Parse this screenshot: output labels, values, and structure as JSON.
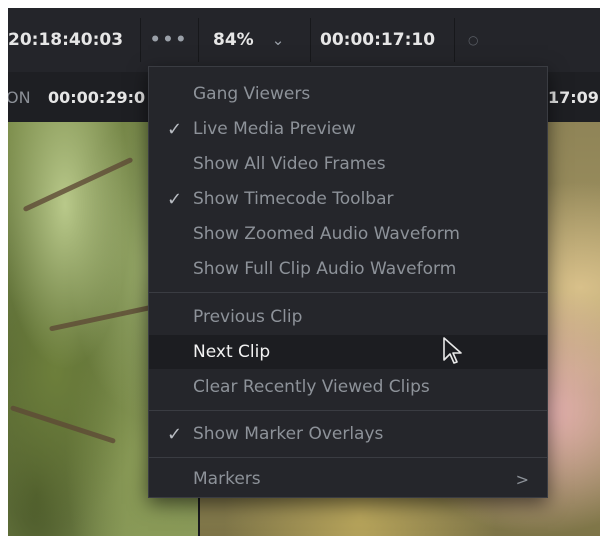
{
  "toolbar": {
    "timecode_left": "20:18:40:03",
    "options_label": "•••",
    "zoom_value": "84%",
    "zoom_chevron": "⌄",
    "timecode_right": "00:00:17:10",
    "status_dot": "○"
  },
  "row2": {
    "left_tag": "ON",
    "timecode_left": "00:00:29:0",
    "timecode_right": "17:09"
  },
  "menu": {
    "items": [
      {
        "label": "Gang Viewers",
        "checked": false,
        "check_glyph": ""
      },
      {
        "label": "Live Media Preview",
        "checked": true,
        "check_glyph": "✓"
      },
      {
        "label": "Show All Video Frames",
        "checked": false,
        "check_glyph": ""
      },
      {
        "label": "Show Timecode Toolbar",
        "checked": true,
        "check_glyph": "✓"
      },
      {
        "label": "Show Zoomed Audio Waveform",
        "checked": false,
        "check_glyph": ""
      },
      {
        "label": "Show Full Clip Audio Waveform",
        "checked": false,
        "check_glyph": ""
      },
      {
        "label": "Previous Clip",
        "checked": false,
        "check_glyph": ""
      },
      {
        "label": "Next Clip",
        "checked": false,
        "check_glyph": "",
        "highlighted": true
      },
      {
        "label": "Clear Recently Viewed Clips",
        "checked": false,
        "check_glyph": ""
      },
      {
        "label": "Show Marker Overlays",
        "checked": true,
        "check_glyph": "✓"
      },
      {
        "label": "Markers",
        "checked": false,
        "check_glyph": "",
        "submenu_arrow": ">"
      }
    ]
  },
  "icons": {
    "check": "checkmark-icon",
    "submenu": "chevron-right-icon",
    "cursor": "mouse-pointer-icon",
    "options": "ellipsis-icon",
    "zoom_dropdown": "chevron-down-icon"
  },
  "colors": {
    "menu_background": "#25262b",
    "menu_highlight": "#1c1d21",
    "menu_text": "#8d9299",
    "menu_text_active": "#f2f2f2",
    "toolbar_background": "#24252a"
  }
}
